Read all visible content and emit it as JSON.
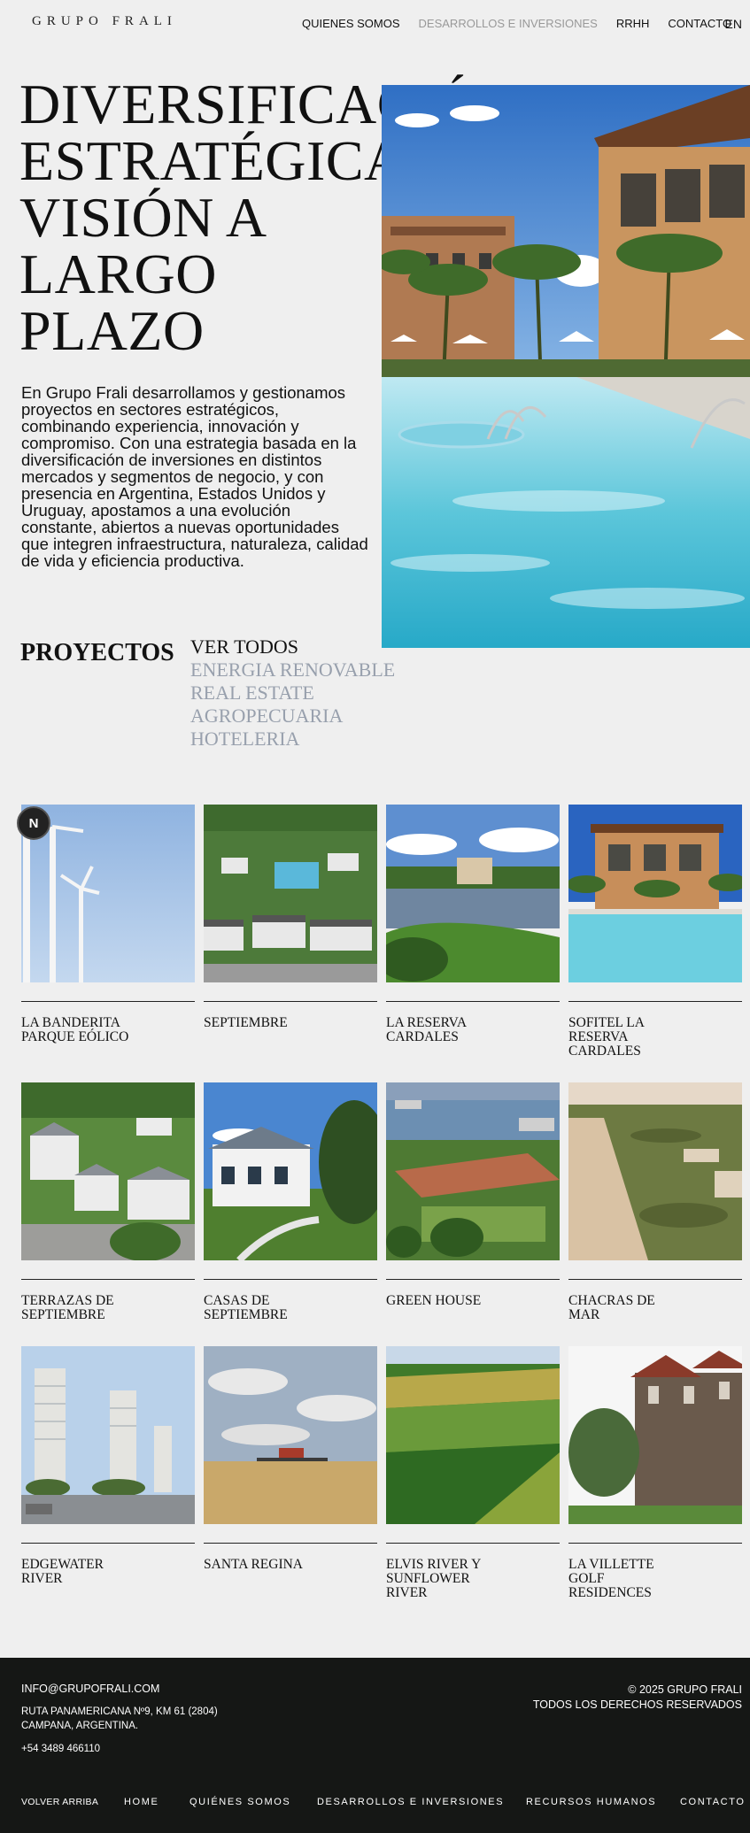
{
  "header": {
    "logo": "GRUPO FRALI",
    "nav": [
      "QUIENES SOMOS",
      "DESARROLLOS E INVERSIONES",
      "RRHH",
      "CONTACTO"
    ],
    "lang": "EN"
  },
  "hero": {
    "title": "DIVERSIFICACIÓN ESTRATÉGICA VISIÓN A LARGO PLAZO",
    "text": "En Grupo Frali desarrollamos y gestionamos proyectos en sectores estratégicos, combinando experiencia, innovación y compromiso. Con una estrategia basada en la diversificación de inversiones en distintos mercados y segmentos de negocio, y con presencia en Argentina, Estados Unidos y Uruguay, apostamos a una evolución constante, abiertos a nuevas oportunidades que integren infraestructura, naturaleza, calidad de vida y eficiencia productiva."
  },
  "projects": {
    "title": "PROYECTOS",
    "filters": [
      "VER TODOS",
      "ENERGIA RENOVABLE",
      "REAL ESTATE",
      "AGROPECUARIA",
      "HOTELERIA"
    ],
    "selected_filter": "VER TODOS",
    "items": [
      "LA BANDERITA PARQUE EÓLICO",
      "SEPTIEMBRE",
      "LA RESERVA CARDALES",
      "SOFITEL LA RESERVA CARDALES",
      "TERRAZAS DE SEPTIEMBRE",
      "CASAS DE SEPTIEMBRE",
      "GREEN HOUSE",
      "CHACRAS DE MAR",
      "EDGEWATER RIVER",
      "SANTA REGINA",
      "ELVIS RIVER Y SUNFLOWER RIVER",
      "LA VILLETTE GOLF RESIDENCES"
    ]
  },
  "badge": "N",
  "footer": {
    "email": "INFO@GRUPOFRALI.COM",
    "address": "RUTA PANAMERICANA Nº9, KM 61 (2804) CAMPANA, ARGENTINA.",
    "phone": "+54 3489 466110",
    "copyright": "© 2025 GRUPO FRALI",
    "rights": "TODOS LOS DERECHOS RESERVADOS",
    "back_to_top": "VOLVER ARRIBA",
    "nav": [
      "HOME",
      "QUIÉNES SOMOS",
      "DESARROLLOS E INVERSIONES",
      "RECURSOS HUMANOS",
      "CONTACTO"
    ]
  }
}
